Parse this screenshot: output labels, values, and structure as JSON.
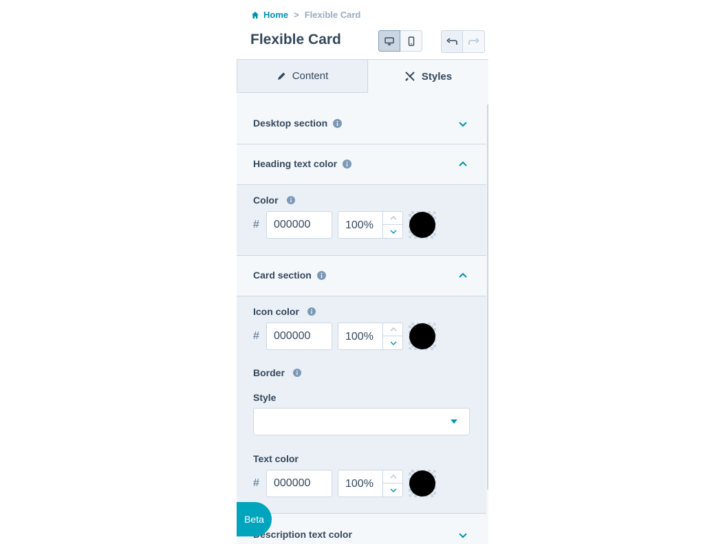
{
  "breadcrumb": {
    "home": "Home",
    "separator": ">",
    "current": "Flexible Card"
  },
  "header": {
    "title": "Flexible Card"
  },
  "tabs": [
    {
      "label": "Content",
      "icon": "pencil-icon"
    },
    {
      "label": "Styles",
      "icon": "paint-tools-icon"
    }
  ],
  "sections": {
    "desktop": {
      "label": "Desktop section"
    },
    "heading": {
      "label": "Heading text color",
      "color_label": "Color",
      "hash": "#",
      "hex": "000000",
      "opacity": "100%",
      "swatch": "#000000"
    },
    "card": {
      "label": "Card section",
      "icon_color_label": "Icon color",
      "icon_hash": "#",
      "icon_hex": "000000",
      "icon_opacity": "100%",
      "icon_swatch": "#000000",
      "border_label": "Border",
      "style_label": "Style",
      "style_value": "",
      "text_color_label": "Text color",
      "text_hash": "#",
      "text_hex": "000000",
      "text_opacity": "100%",
      "text_swatch": "#000000"
    },
    "description": {
      "label": "Description text color"
    }
  },
  "beta": {
    "label": "Beta"
  },
  "colors": {
    "accent": "#0091ae",
    "teal": "#00a4bd",
    "text": "#33475b",
    "border": "#cbd6e2"
  }
}
